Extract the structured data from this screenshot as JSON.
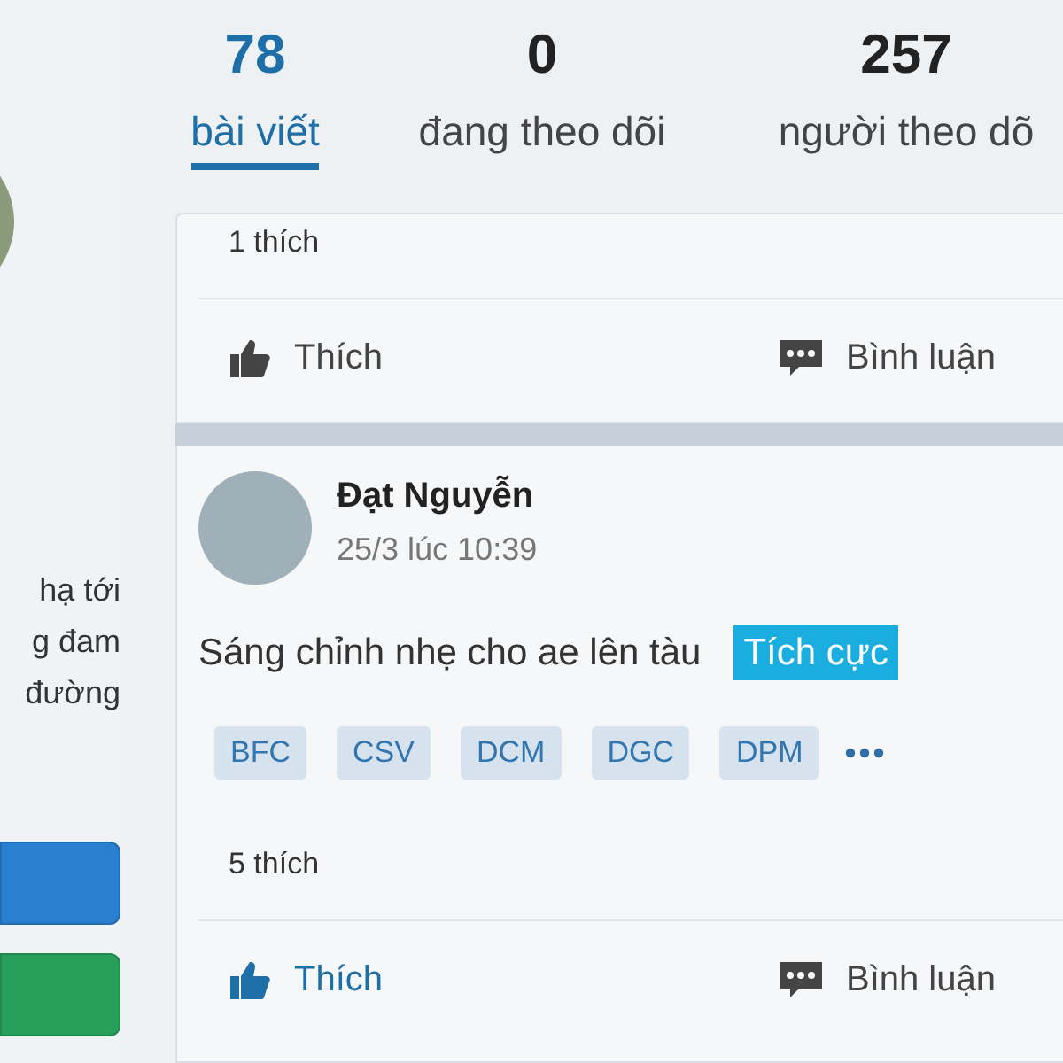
{
  "sidebar": {
    "intro_lines": [
      "hạ tới",
      "g đam",
      "đường"
    ],
    "buttons": [
      {
        "color": "#2a7fcf"
      },
      {
        "color": "#28a05c"
      }
    ]
  },
  "stats": [
    {
      "value": "78",
      "label": "bài viết",
      "selected": true
    },
    {
      "value": "0",
      "label": "đang theo dõi",
      "selected": false
    },
    {
      "value": "257",
      "label": "người theo dõ",
      "selected": false
    }
  ],
  "posts": [
    {
      "likes": "1 thích",
      "actions": [
        {
          "kind": "like",
          "label": "Thích",
          "active": false
        },
        {
          "kind": "comment",
          "label": "Bình luận",
          "active": false
        }
      ]
    },
    {
      "author": "Đạt Nguyễn",
      "time": "25/3 lúc 10:39",
      "text": "Sáng chỉnh nhẹ cho ae lên tàu",
      "sentiment": "Tích cực",
      "tickers": [
        "BFC",
        "CSV",
        "DCM",
        "DGC",
        "DPM"
      ],
      "more": true,
      "likes": "5 thích",
      "actions": [
        {
          "kind": "like",
          "label": "Thích",
          "active": true
        },
        {
          "kind": "comment",
          "label": "Bình luận",
          "active": false
        }
      ]
    }
  ]
}
